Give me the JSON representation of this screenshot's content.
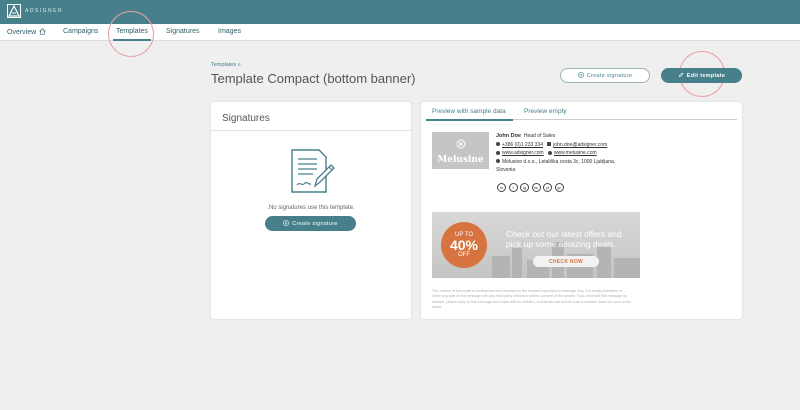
{
  "app": {
    "brand": "ADSIGNER",
    "colors": {
      "primary": "#47808a",
      "accent": "#d6733e",
      "annotation": "#eaa2a2"
    }
  },
  "nav": {
    "items": [
      {
        "label": "Overview",
        "icon": "home-icon"
      },
      {
        "label": "Campaigns"
      },
      {
        "label": "Templates",
        "active": true
      },
      {
        "label": "Signatures"
      },
      {
        "label": "Images"
      }
    ]
  },
  "page": {
    "breadcrumb": "Templates »",
    "title": "Template Compact (bottom banner)",
    "actions": {
      "create_signature": "Create signature",
      "edit_template": "Edit template"
    }
  },
  "signatures_card": {
    "title": "Signatures",
    "empty_text": ".No signatures use this template.",
    "button": "Create signature"
  },
  "preview_card": {
    "tabs": [
      {
        "label": "Preview with sample data",
        "active": true
      },
      {
        "label": "Preview empty"
      }
    ],
    "signature": {
      "logo_text": "Melusine",
      "name": "John Doe",
      "title": "Head of Sales",
      "phone": "+386 (0)1 233 334",
      "email": "john.doe@adsigner.com",
      "website1": "www.adsigner.com",
      "website2": "www.melusine.com",
      "address": "Melusine d.o.o., Letališka cesta 3c, 1000 Ljubljana,",
      "country": "Slovenia",
      "social": [
        "in",
        "f",
        "ig",
        "tw",
        "yt",
        "gr"
      ]
    },
    "banner": {
      "badge_top": "UP TO",
      "badge_value": "40%",
      "badge_bottom": "OFF",
      "headline": "Check out our latest offers and pick up some amazing deals.",
      "cta": "CHECK NOW"
    },
    "disclaimer": "The content of this email is confidential and intended for the recipient specified in message only. It is strictly forbidden to share any part of this message with any third party without a written consent of the sender. If you received this message by mistake, please reply to this message and follow with its deletion, so that we can ensure such a mistake does not occur in the future."
  }
}
